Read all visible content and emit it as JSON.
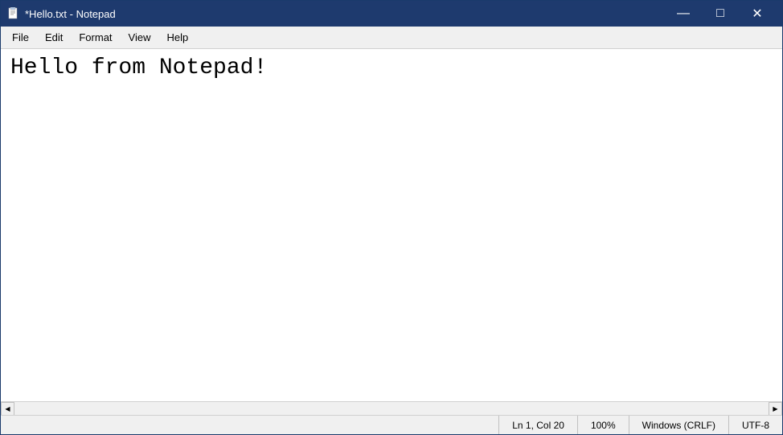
{
  "titleBar": {
    "icon": "notepad",
    "title": "*Hello.txt - Notepad",
    "minimize": "—",
    "maximize": "□",
    "close": "✕"
  },
  "menuBar": {
    "items": [
      "File",
      "Edit",
      "Format",
      "View",
      "Help"
    ]
  },
  "editor": {
    "content": "Hello from Notepad!"
  },
  "statusBar": {
    "position": "Ln 1, Col 20",
    "zoom": "100%",
    "lineEnding": "Windows (CRLF)",
    "encoding": "UTF-8"
  }
}
